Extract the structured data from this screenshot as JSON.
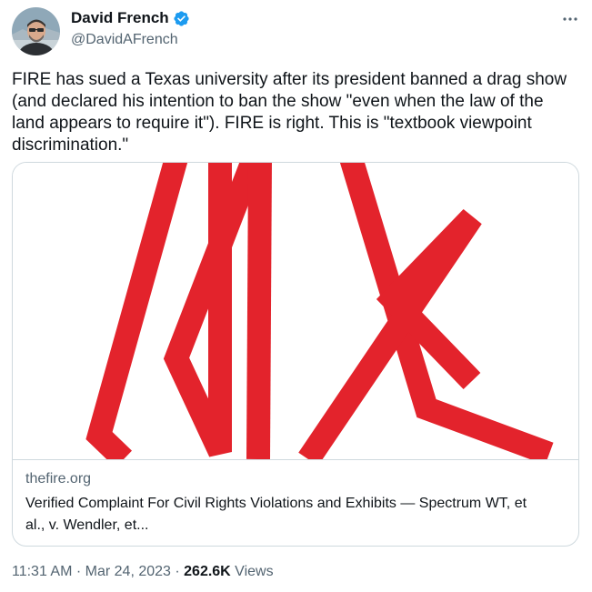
{
  "author": {
    "display_name": "David French",
    "handle": "@DavidAFrench",
    "verified_icon": "verified-badge-icon",
    "avatar_icon": "avatar-photo"
  },
  "tweet": {
    "text": "FIRE has sued a Texas university after its president banned a drag show\n(and declared his intention to ban the show \"even when the law of the\nland appears to require it\"). FIRE is right. This is \"textbook viewpoint\ndiscrimination.\""
  },
  "card": {
    "image_icon": "red-logo-graphic",
    "domain": "thefire.org",
    "title": "Verified Complaint For Civil Rights Violations and Exhibits — Spectrum WT, et\nal., v. Wendler, et..."
  },
  "meta": {
    "time": "11:31 AM",
    "separator": " · ",
    "date": "Mar 24, 2023",
    "separator2": " · ",
    "views_count": "262.6K",
    "views_label": " Views"
  },
  "colors": {
    "accent": "#1d9bf0",
    "logo_red": "#e3232c",
    "secondary_text": "#536471",
    "border": "#cfd9de"
  }
}
